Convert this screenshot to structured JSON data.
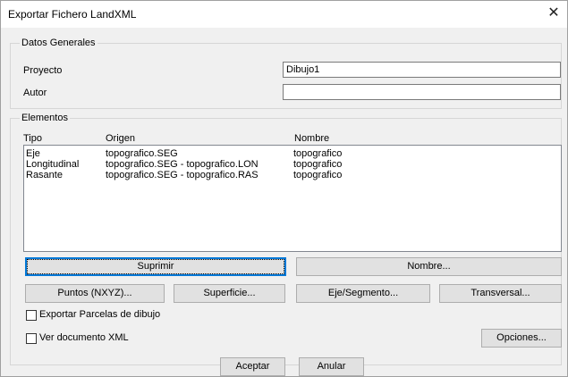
{
  "window": {
    "title": "Exportar Fichero LandXML",
    "close_glyph": "✕"
  },
  "general": {
    "group_label": "Datos Generales",
    "proyecto_label": "Proyecto",
    "proyecto_value": "Dibujo1",
    "autor_label": "Autor",
    "autor_value": ""
  },
  "elementos": {
    "group_label": "Elementos",
    "columns": {
      "tipo": "Tipo",
      "origen": "Origen",
      "nombre": "Nombre"
    },
    "rows": [
      {
        "tipo": "Eje",
        "origen": "topografico.SEG",
        "nombre": "topografico"
      },
      {
        "tipo": "Longitudinal",
        "origen": "topografico.SEG - topografico.LON",
        "nombre": "topografico"
      },
      {
        "tipo": "Rasante",
        "origen": "topografico.SEG - topografico.RAS",
        "nombre": "topografico"
      }
    ]
  },
  "buttons": {
    "suprimir": "Suprimir",
    "nombre": "Nombre...",
    "puntos": "Puntos (NXYZ)...",
    "superficie": "Superficie...",
    "eje_segmento": "Eje/Segmento...",
    "transversal": "Transversal...",
    "opciones": "Opciones...",
    "aceptar": "Aceptar",
    "anular": "Anular"
  },
  "checkboxes": {
    "exportar_parcelas": {
      "label": "Exportar Parcelas de dibujo",
      "checked": false
    },
    "ver_documento": {
      "label": "Ver documento XML",
      "checked": false
    }
  }
}
